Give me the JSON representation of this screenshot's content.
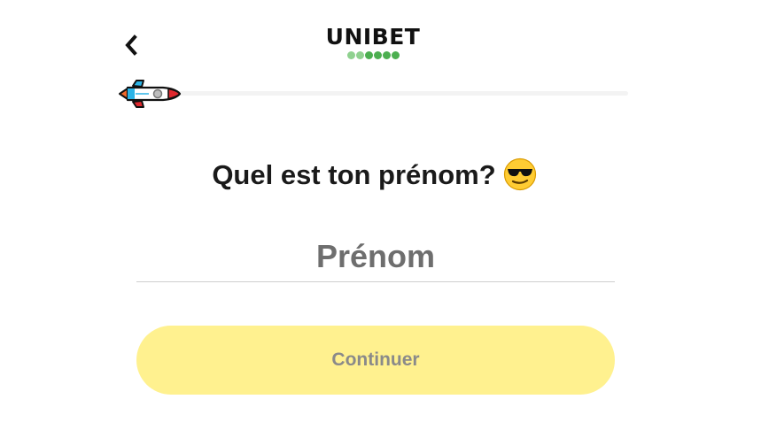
{
  "header": {
    "back_icon": "chevron-left-icon",
    "logo_text": "UNIBET",
    "logo_dots_icon": "brand-dots"
  },
  "progress": {
    "icon": "rocket-icon",
    "fraction": 0.0
  },
  "form": {
    "question": "Quel est ton prénom?",
    "question_emoji": "sunglasses-face-emoji",
    "name_value": "",
    "name_placeholder": "Prénom",
    "continue_label": "Continuer"
  },
  "colors": {
    "button_bg": "#fff18f",
    "button_text": "#8a8a8a",
    "brand_green": "#4caf50",
    "track": "#f3f3f3"
  }
}
